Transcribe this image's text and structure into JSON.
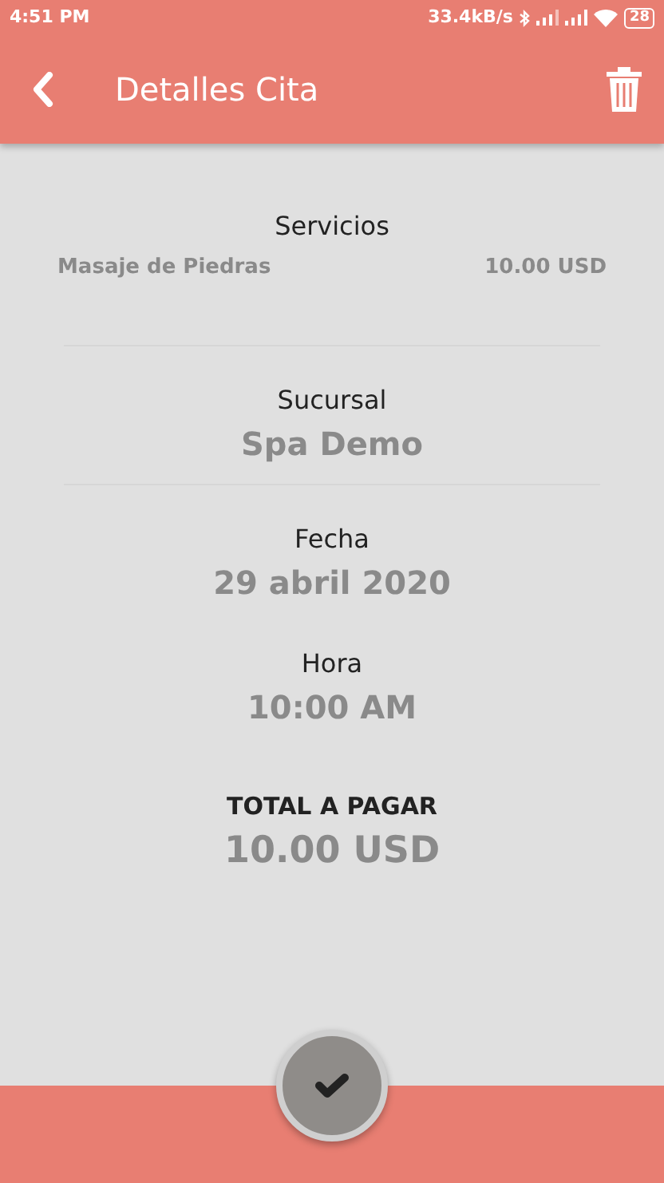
{
  "status_bar": {
    "time": "4:51 PM",
    "speed": "33.4kB/s",
    "battery": "28"
  },
  "header": {
    "title": "Detalles Cita"
  },
  "services": {
    "heading": "Servicios",
    "items": [
      {
        "name": "Masaje de Piedras",
        "price": "10.00 USD"
      }
    ]
  },
  "fields": [
    {
      "label": "Sucursal",
      "value": "Spa Demo",
      "divider": true
    },
    {
      "label": "Fecha",
      "value": "29 abril 2020",
      "divider": false
    },
    {
      "label": "Hora",
      "value": "10:00 AM",
      "divider": false
    }
  ],
  "total": {
    "label": "TOTAL A PAGAR",
    "value": "10.00 USD"
  }
}
